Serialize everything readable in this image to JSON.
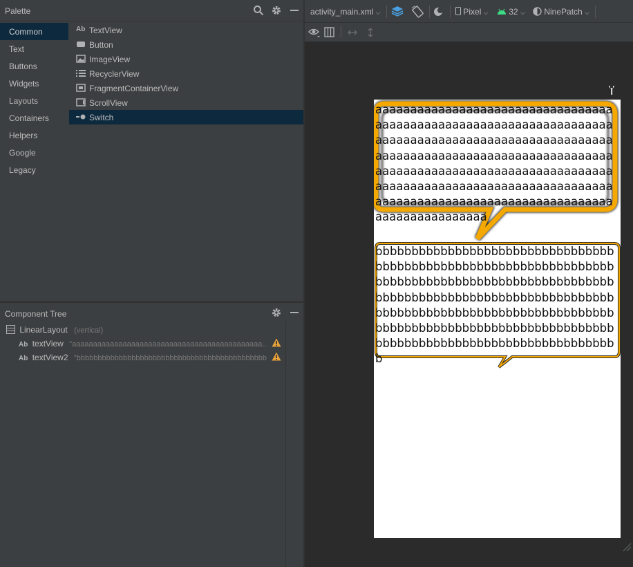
{
  "palette": {
    "title": "Palette",
    "categories": [
      "Common",
      "Text",
      "Buttons",
      "Widgets",
      "Layouts",
      "Containers",
      "Helpers",
      "Google",
      "Legacy"
    ],
    "selected_category": "Common",
    "items": [
      {
        "icon": "textview-icon",
        "glyph": "Ab",
        "label": "TextView"
      },
      {
        "icon": "button-icon",
        "glyph": "",
        "label": "Button"
      },
      {
        "icon": "imageview-icon",
        "glyph": "",
        "label": "ImageView"
      },
      {
        "icon": "recyclerview-icon",
        "glyph": "",
        "label": "RecyclerView"
      },
      {
        "icon": "fragmentcontainerview-icon",
        "glyph": "",
        "label": "FragmentContainerView"
      },
      {
        "icon": "scrollview-icon",
        "glyph": "",
        "label": "ScrollView"
      },
      {
        "icon": "switch-icon",
        "glyph": "",
        "label": "Switch"
      }
    ],
    "selected_item": "Switch"
  },
  "component_tree": {
    "title": "Component Tree",
    "root": {
      "label": "LinearLayout",
      "hint": "(vertical)"
    },
    "children": [
      {
        "label": "textView",
        "hint": "\"aaaaaaaaaaaaaaaaaaaaaaaaaaaaaaaaaaaaaaaaaaaaa..."
      },
      {
        "label": "textView2",
        "hint": "\"bbbbbbbbbbbbbbbbbbbbbbbbbbbbbbbbbbbbbbbbbbbbb..."
      }
    ]
  },
  "toolbar": {
    "file": "activity_main.xml",
    "device": "Pixel",
    "api": "32",
    "theme": "NinePatch"
  },
  "preview": {
    "text_a": "aaaaaaaaaaaaaaaaaaaaaaaaaaaaaaaaaaaaaaaaaaaaaaaaaaaaaaaaaaaaaaaaaaaaaaaaaaaaaaaaaaaaaaaaaaaaaaaaaaaaaaaaaaaaaaaaaaaaaaaaaaaaaaaaaaaaaaaaaaaaaaaaaaaaaaaaaaaaaaaaaaaaaaaaaaaaaaaaaaaaaaaaaaaaaaaaaaaaaaaaaaaaaaaaaaaaaaaaaaaaaaaaaaaaaaaaaaaaaaaaaaaaaaaaaaaaaa",
    "text_b": "bbbbbbbbbbbbbbbbbbbbbbbbbbbbbbbbbbbbbbbbbbbbbbbbbbbbbbbbbbbbbbbbbbbbbbbbbbbbbbbbbbbbbbbbbbbbbbbbbbbbbbbbbbbbbbbbbbbbbbbbbbbbbbbbbbbbbbbbbbbbbbbbbbbbbbbbbbbbbbbbbbbbbbbbbbbbbbbbbbbbbbbbbbbbbbbbbbbbbbbbbbbbbbbbbbbbbbbbbbbbbbbbbbbbbbbb"
  },
  "colors": {
    "panel_bg": "#3c3f41",
    "selection": "#0d293e",
    "bubble_orange": "#f5a800",
    "warning": "#e8a33a"
  }
}
